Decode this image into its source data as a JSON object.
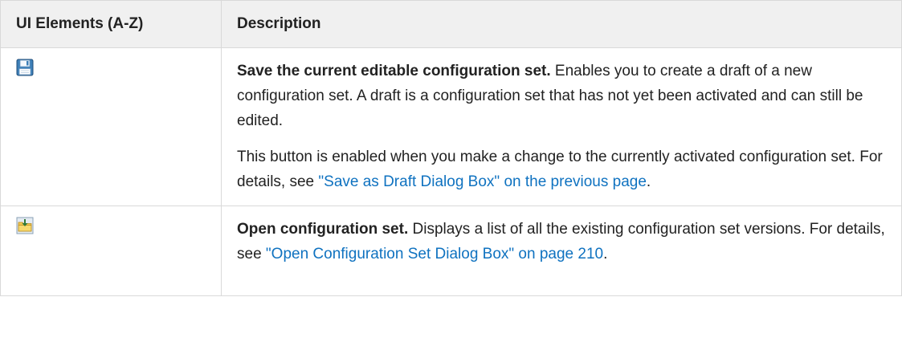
{
  "table": {
    "headers": [
      "UI Elements (A-Z)",
      "Description"
    ],
    "rows": [
      {
        "icon": "save-icon",
        "title": "Save the current editable configuration set.",
        "paragraph1_rest": " Enables you to create a draft of a new configuration set. A draft is a configuration set that has not yet been activated and can still be edited.",
        "paragraph2_text": "This button is enabled when you make a change to the currently activated configuration set. For details, see ",
        "paragraph2_link": "\"Save as Draft Dialog Box\" on the previous page",
        "paragraph2_end": "."
      },
      {
        "icon": "open-folder-icon",
        "title": "Open configuration set.",
        "paragraph1_rest": " Displays a list of all the existing configuration set versions. For details, see ",
        "paragraph1_link": "\"Open Configuration Set Dialog Box\" on page 210",
        "paragraph1_end": "."
      }
    ]
  },
  "colors": {
    "link": "#0f72c0",
    "header_bg": "#f0f0f0",
    "border": "#d9d9d9"
  }
}
